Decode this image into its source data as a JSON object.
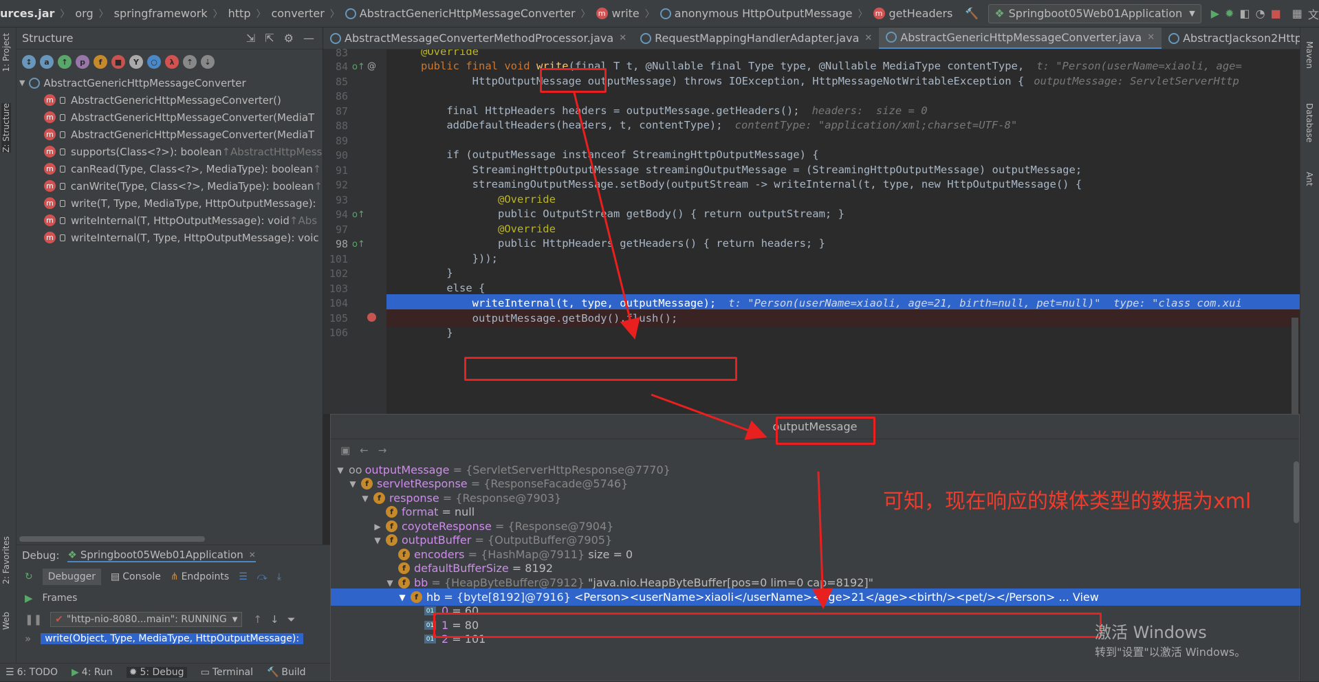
{
  "breadcrumb": [
    "urces.jar",
    "org",
    "springframework",
    "http",
    "converter",
    "AbstractGenericHttpMessageConverter",
    "write",
    "anonymous HttpOutputMessage",
    "getHeaders"
  ],
  "run_config": "Springboot05Web01Application",
  "left_strip": {
    "project": "1: Project",
    "structure": "Z: Structure",
    "favorites": "2: Favorites",
    "web": "Web"
  },
  "right_strip": {
    "maven": "Maven",
    "database": "Database",
    "ant": "Ant"
  },
  "structure": {
    "title": "Structure",
    "root": "AbstractGenericHttpMessageConverter",
    "items": [
      {
        "label": "AbstractGenericHttpMessageConverter()",
        "suffix": ""
      },
      {
        "label": "AbstractGenericHttpMessageConverter(MediaT",
        "suffix": ""
      },
      {
        "label": "AbstractGenericHttpMessageConverter(MediaT",
        "suffix": ""
      },
      {
        "label": "supports(Class<?>): boolean",
        "suffix": "↑AbstractHttpMess"
      },
      {
        "label": "canRead(Type, Class<?>, MediaType): boolean",
        "suffix": "↑"
      },
      {
        "label": "canWrite(Type, Class<?>, MediaType): boolean",
        "suffix": "↑"
      },
      {
        "label": "write(T, Type, MediaType, HttpOutputMessage):",
        "suffix": ""
      },
      {
        "label": "writeInternal(T, HttpOutputMessage): void",
        "suffix": "↑Abs"
      },
      {
        "label": "writeInternal(T, Type, HttpOutputMessage): voic",
        "suffix": ""
      }
    ]
  },
  "tabs": [
    {
      "label": "AbstractMessageConverterMethodProcessor.java",
      "active": false
    },
    {
      "label": "RequestMappingHandlerAdapter.java",
      "active": false
    },
    {
      "label": "AbstractGenericHttpMessageConverter.java",
      "active": true
    },
    {
      "label": "AbstractJackson2HttpMessa",
      "active": false
    }
  ],
  "code": {
    "line_numbers": [
      "83",
      "84",
      "85",
      "86",
      "87",
      "88",
      "89",
      "90",
      "91",
      "92",
      "93",
      "94",
      "97",
      "98",
      "101",
      "102",
      "103",
      "104",
      "105",
      "106"
    ],
    "lines": {
      "l83": "@Override",
      "l84a": "public final void ",
      "l84b": "write",
      "l84c": "(final T t, @Nullable final Type type, @Nullable MediaType contentType,",
      "l84h": "t: \"Person(userName=xiaoli, age=",
      "l85": "        HttpOutputMessage outputMessage) throws IOException, HttpMessageNotWritableException {",
      "l85h": "outputMessage: ServletServerHttp",
      "l87": "    final HttpHeaders headers = outputMessage.getHeaders();",
      "l87h": "headers:  size = 0",
      "l88": "    addDefaultHeaders(headers, t, contentType);",
      "l88h": "contentType: \"application/xml;charset=UTF-8\"",
      "l90": "    if (outputMessage instanceof StreamingHttpOutputMessage) {",
      "l91": "        StreamingHttpOutputMessage streamingOutputMessage = (StreamingHttpOutputMessage) outputMessage;",
      "l92": "        streamingOutputMessage.setBody(outputStream -> writeInternal(t, type, new HttpOutputMessage() {",
      "l93": "            @Override",
      "l94": "            public OutputStream getBody() { return outputStream; }",
      "l97": "            @Override",
      "l98": "            public HttpHeaders getHeaders() { return headers; }",
      "l101": "        }));",
      "l102": "    }",
      "l103": "    else {",
      "l104": "        writeInternal(t, type, outputMessage);",
      "l104h": "t: \"Person(userName=xiaoli, age=21, birth=null, pet=null)\"  type: \"class com.xui",
      "l105": "        outputMessage.getBody().flush();",
      "l106": "    }"
    }
  },
  "popup": {
    "title": "outputMessage",
    "rows": [
      {
        "name": "outputMessage",
        "value": "= {ServletServerHttpResponse@7770}",
        "extra": ""
      },
      {
        "name": "servletResponse",
        "value": "= {ResponseFacade@5746}",
        "extra": ""
      },
      {
        "name": "response",
        "value": "= {Response@7903}",
        "extra": ""
      },
      {
        "name": "format",
        "value": "= null",
        "extra": ""
      },
      {
        "name": "coyoteResponse",
        "value": "= {Response@7904}",
        "extra": ""
      },
      {
        "name": "outputBuffer",
        "value": "= {OutputBuffer@7905}",
        "extra": ""
      },
      {
        "name": "encoders",
        "value": "= {HashMap@7911}",
        "extra": "size = 0"
      },
      {
        "name": "defaultBufferSize",
        "value": "= 8192",
        "extra": ""
      },
      {
        "name": "bb",
        "value": "= {HeapByteBuffer@7912}",
        "extra": "\"java.nio.HeapByteBuffer[pos=0 lim=0 cap=8192]\""
      },
      {
        "name": "hb",
        "value": "= {byte[8192]@7916}",
        "extra": "<Person><userName>xiaoli</userName><age>21</age><birth/><pet/></Person> ... View"
      },
      {
        "name": "0",
        "value": "= 60",
        "extra": ""
      },
      {
        "name": "1",
        "value": "= 80",
        "extra": ""
      },
      {
        "name": "2",
        "value": "= 101",
        "extra": ""
      }
    ]
  },
  "annotation": "可知，现在响应的媒体类型的数据为xml",
  "debug": {
    "label": "Debug:",
    "config": "Springboot05Web01Application",
    "tabs": [
      "Debugger",
      "Console",
      "Endpoints"
    ],
    "frames_label": "Frames",
    "thread": "\"http-nio-8080...main\": RUNNING",
    "frame": "write(Object, Type, MediaType, HttpOutputMessage):"
  },
  "bottom_tabs": [
    "6: TODO",
    "4: Run",
    "5: Debug",
    "Terminal",
    "Build"
  ],
  "watermark": {
    "line1": "激活 Windows",
    "line2": "转到\"设置\"以激活 Windows。"
  },
  "colors": {
    "selection": "#2f65ca",
    "breakpoint_line": "#3a2323",
    "annotation_red": "#e8201f"
  }
}
